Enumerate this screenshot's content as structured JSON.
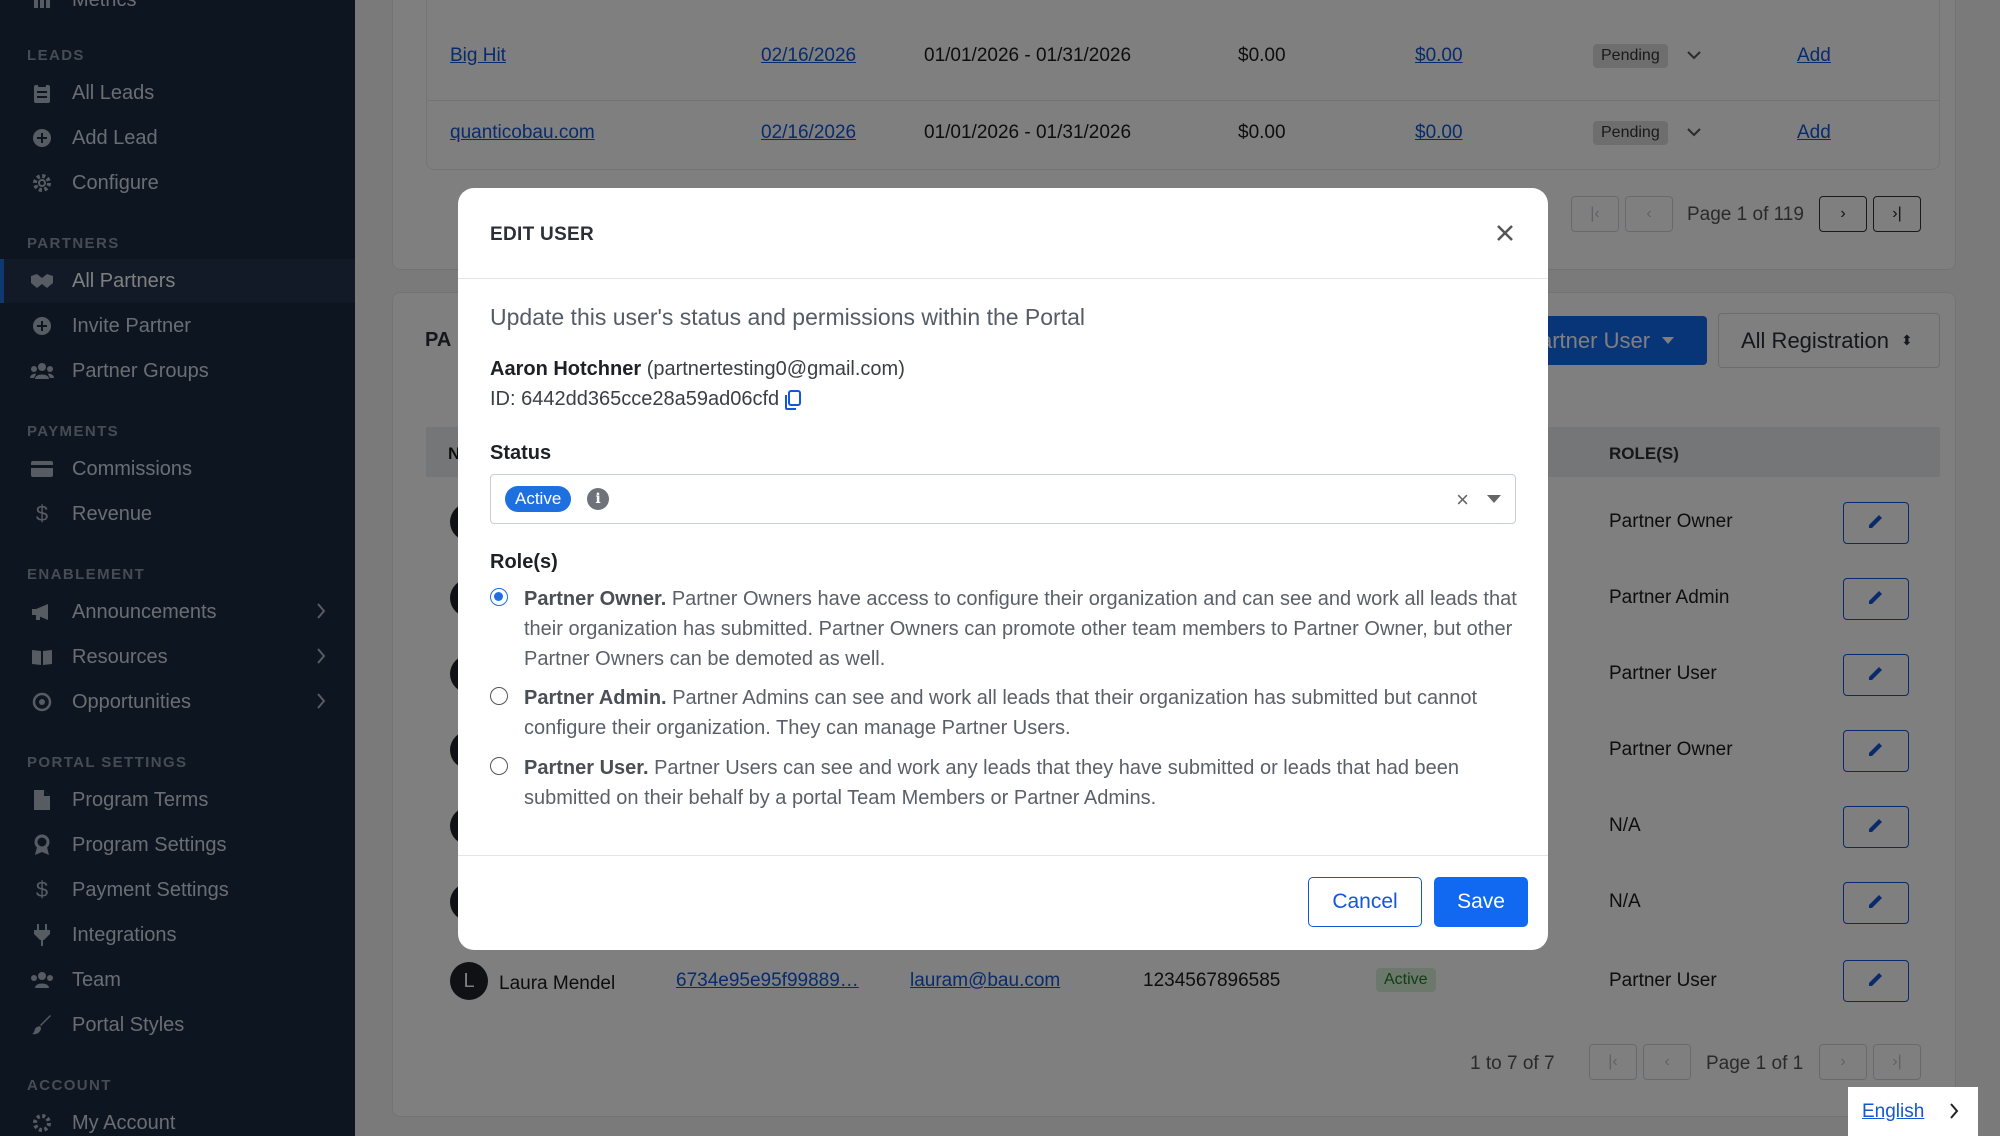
{
  "sidebar": {
    "partial_top_label": "Metrics",
    "sections": {
      "leads": "LEADS",
      "partners": "PARTNERS",
      "payments": "PAYMENTS",
      "enablement": "ENABLEMENT",
      "portal_settings": "PORTAL SETTINGS",
      "account": "ACCOUNT"
    },
    "items": {
      "all_leads": "All Leads",
      "add_lead": "Add Lead",
      "configure": "Configure",
      "all_partners": "All Partners",
      "invite_partner": "Invite Partner",
      "partner_groups": "Partner Groups",
      "commissions": "Commissions",
      "revenue": "Revenue",
      "announcements": "Announcements",
      "resources": "Resources",
      "opportunities": "Opportunities",
      "program_terms": "Program Terms",
      "program_settings": "Program Settings",
      "payment_settings": "Payment Settings",
      "integrations": "Integrations",
      "team": "Team",
      "portal_styles": "Portal Styles",
      "my_account": "My Account"
    },
    "active_item": "All Partners"
  },
  "leads_table": {
    "rows": [
      {
        "name": "Big Hit",
        "date": "02/16/2026",
        "period": "01/01/2026 - 01/31/2026",
        "amount": "$0.00",
        "amount_link": "$0.00",
        "status": "Pending",
        "action": "Add"
      },
      {
        "name": "quanticobau.com",
        "date": "02/16/2026",
        "period": "01/01/2026 - 01/31/2026",
        "amount": "$0.00",
        "amount_link": "$0.00",
        "status": "Pending",
        "action": "Add"
      }
    ],
    "pager": {
      "label": "Page 1 of 119"
    }
  },
  "users_card": {
    "title_partial": "PA",
    "filter_role": "artner User",
    "filter_registration": "All Registration",
    "col_first_partial": "N",
    "col_roles": "ROLE(S)",
    "roles": [
      "Partner Owner",
      "Partner Admin",
      "Partner User",
      "Partner Owner",
      "N/A",
      "N/A",
      "Partner User"
    ],
    "last_row": {
      "avatar_letter": "L",
      "name": "Laura Mendel",
      "id": "6734e95e95f99889…",
      "email": "lauram@bau.com",
      "phone": "1234567896585",
      "status": "Active",
      "role": "Partner User"
    },
    "count": "1 to 7 of 7",
    "pager": {
      "label": "Page 1 of 1"
    }
  },
  "modal": {
    "title": "EDIT USER",
    "subtitle": "Update this user's status and permissions within the Portal",
    "user_name": "Aaron Hotchner",
    "user_email": "(partnertesting0@gmail.com)",
    "user_id": "ID: 6442dd365cce28a59ad06cfd",
    "status_label": "Status",
    "status_value": "Active",
    "roles_label": "Role(s)",
    "roles": [
      {
        "name": "Partner Owner.",
        "desc": "Partner Owners have access to configure their organization and can see and work all leads that their organization has submitted. Partner Owners can promote other team members to Partner Owner, but other Partner Owners can be demoted as well.",
        "selected": true
      },
      {
        "name": "Partner Admin.",
        "desc": "Partner Admins can see and work all leads that their organization has submitted but cannot configure their organization. They can manage Partner Users.",
        "selected": false
      },
      {
        "name": "Partner User.",
        "desc": "Partner Users can see and work any leads that they have submitted or leads that had been submitted on their behalf by a portal Team Members or Partner Admins.",
        "selected": false
      }
    ],
    "cancel_label": "Cancel",
    "save_label": "Save"
  },
  "language": {
    "label": "English"
  },
  "colors": {
    "sidebar": "#1b2b41",
    "accent": "#1069f0",
    "overlay": "rgba(0,0,0,0.5)"
  }
}
